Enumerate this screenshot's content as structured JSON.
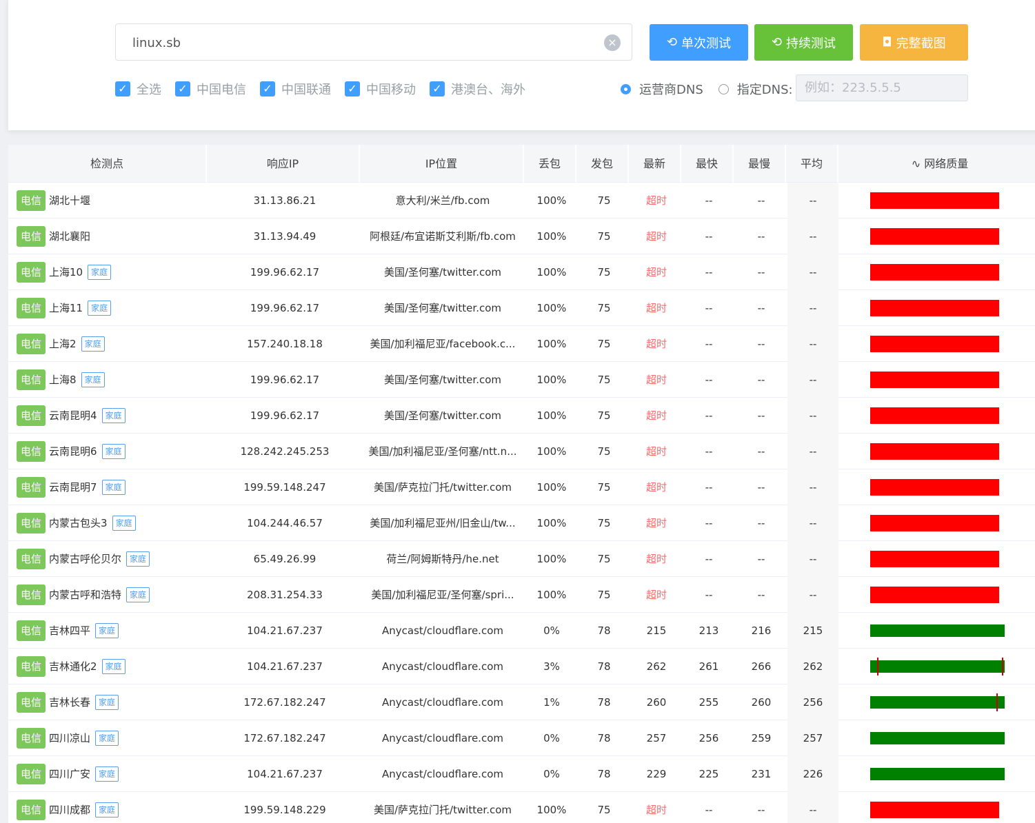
{
  "search": {
    "value": "linux.sb",
    "clear_icon": "×"
  },
  "buttons": {
    "single": {
      "icon": "⟲",
      "label": "单次测试"
    },
    "continuous": {
      "icon": "⟲",
      "label": "持续测试"
    },
    "screenshot": {
      "icon": "◘",
      "label": "完整截图"
    }
  },
  "filters": [
    {
      "label": "全选",
      "checked": true
    },
    {
      "label": "中国电信",
      "checked": true
    },
    {
      "label": "中国联通",
      "checked": true
    },
    {
      "label": "中国移动",
      "checked": true
    },
    {
      "label": "港澳台、海外",
      "checked": true
    }
  ],
  "dns": {
    "option_isp": "运营商DNS",
    "option_custom": "指定DNS:",
    "selected": "运营商DNS",
    "custom_placeholder": "例如：223.5.5.5"
  },
  "table": {
    "headers": {
      "loc": "检测点",
      "ip": "响应IP",
      "pos": "IP位置",
      "loss": "丢包",
      "sent": "发包",
      "last": "最新",
      "fast": "最快",
      "slow": "最慢",
      "avg": "平均",
      "quality_icon": "∿",
      "quality": "网络质量"
    },
    "isp_tag": "电信",
    "home_tag": "家庭",
    "timeout": "超时",
    "rows": [
      {
        "isp": "电信",
        "name": "湖北十堰",
        "home": "",
        "ip": "31.13.86.21",
        "pos": "意大利/米兰/fb.com",
        "loss": "100%",
        "sent": "75",
        "last": "超时",
        "fast": "--",
        "slow": "--",
        "avg": "--",
        "quality": "bad"
      },
      {
        "isp": "电信",
        "name": "湖北襄阳",
        "home": "",
        "ip": "31.13.94.49",
        "pos": "阿根廷/布宜诺斯艾利斯/fb.com",
        "loss": "100%",
        "sent": "75",
        "last": "超时",
        "fast": "--",
        "slow": "--",
        "avg": "--",
        "quality": "bad"
      },
      {
        "isp": "电信",
        "name": "上海10",
        "home": "家庭",
        "ip": "199.96.62.17",
        "pos": "美国/圣何塞/twitter.com",
        "loss": "100%",
        "sent": "75",
        "last": "超时",
        "fast": "--",
        "slow": "--",
        "avg": "--",
        "quality": "bad"
      },
      {
        "isp": "电信",
        "name": "上海11",
        "home": "家庭",
        "ip": "199.96.62.17",
        "pos": "美国/圣何塞/twitter.com",
        "loss": "100%",
        "sent": "75",
        "last": "超时",
        "fast": "--",
        "slow": "--",
        "avg": "--",
        "quality": "bad"
      },
      {
        "isp": "电信",
        "name": "上海2",
        "home": "家庭",
        "ip": "157.240.18.18",
        "pos": "美国/加利福尼亚/facebook.c...",
        "loss": "100%",
        "sent": "75",
        "last": "超时",
        "fast": "--",
        "slow": "--",
        "avg": "--",
        "quality": "bad"
      },
      {
        "isp": "电信",
        "name": "上海8",
        "home": "家庭",
        "ip": "199.96.62.17",
        "pos": "美国/圣何塞/twitter.com",
        "loss": "100%",
        "sent": "75",
        "last": "超时",
        "fast": "--",
        "slow": "--",
        "avg": "--",
        "quality": "bad"
      },
      {
        "isp": "电信",
        "name": "云南昆明4",
        "home": "家庭",
        "ip": "199.96.62.17",
        "pos": "美国/圣何塞/twitter.com",
        "loss": "100%",
        "sent": "75",
        "last": "超时",
        "fast": "--",
        "slow": "--",
        "avg": "--",
        "quality": "bad"
      },
      {
        "isp": "电信",
        "name": "云南昆明6",
        "home": "家庭",
        "ip": "128.242.245.253",
        "pos": "美国/加利福尼亚/圣何塞/ntt.n...",
        "loss": "100%",
        "sent": "75",
        "last": "超时",
        "fast": "--",
        "slow": "--",
        "avg": "--",
        "quality": "bad"
      },
      {
        "isp": "电信",
        "name": "云南昆明7",
        "home": "家庭",
        "ip": "199.59.148.247",
        "pos": "美国/萨克拉门托/twitter.com",
        "loss": "100%",
        "sent": "75",
        "last": "超时",
        "fast": "--",
        "slow": "--",
        "avg": "--",
        "quality": "bad"
      },
      {
        "isp": "电信",
        "name": "内蒙古包头3",
        "home": "家庭",
        "ip": "104.244.46.57",
        "pos": "美国/加利福尼亚州/旧金山/tw...",
        "loss": "100%",
        "sent": "75",
        "last": "超时",
        "fast": "--",
        "slow": "--",
        "avg": "--",
        "quality": "bad"
      },
      {
        "isp": "电信",
        "name": "内蒙古呼伦贝尔",
        "home": "家庭",
        "ip": "65.49.26.99",
        "pos": "荷兰/阿姆斯特丹/he.net",
        "loss": "100%",
        "sent": "75",
        "last": "超时",
        "fast": "--",
        "slow": "--",
        "avg": "--",
        "quality": "bad"
      },
      {
        "isp": "电信",
        "name": "内蒙古呼和浩特",
        "home": "家庭",
        "ip": "208.31.254.33",
        "pos": "美国/加利福尼亚/圣何塞/spri...",
        "loss": "100%",
        "sent": "75",
        "last": "超时",
        "fast": "--",
        "slow": "--",
        "avg": "--",
        "quality": "bad"
      },
      {
        "isp": "电信",
        "name": "吉林四平",
        "home": "家庭",
        "ip": "104.21.67.237",
        "pos": "Anycast/cloudflare.com",
        "loss": "0%",
        "sent": "78",
        "last": "215",
        "fast": "213",
        "slow": "216",
        "avg": "215",
        "quality": "good",
        "ticks": []
      },
      {
        "isp": "电信",
        "name": "吉林通化2",
        "home": "家庭",
        "ip": "104.21.67.237",
        "pos": "Anycast/cloudflare.com",
        "loss": "3%",
        "sent": "78",
        "last": "262",
        "fast": "261",
        "slow": "266",
        "avg": "262",
        "quality": "good",
        "ticks": [
          0.05,
          0.98
        ]
      },
      {
        "isp": "电信",
        "name": "吉林长春",
        "home": "家庭",
        "ip": "172.67.182.247",
        "pos": "Anycast/cloudflare.com",
        "loss": "1%",
        "sent": "78",
        "last": "260",
        "fast": "255",
        "slow": "260",
        "avg": "256",
        "quality": "good",
        "ticks": [
          0.94
        ]
      },
      {
        "isp": "电信",
        "name": "四川凉山",
        "home": "家庭",
        "ip": "172.67.182.247",
        "pos": "Anycast/cloudflare.com",
        "loss": "0%",
        "sent": "78",
        "last": "257",
        "fast": "256",
        "slow": "259",
        "avg": "257",
        "quality": "good",
        "ticks": []
      },
      {
        "isp": "电信",
        "name": "四川广安",
        "home": "家庭",
        "ip": "104.21.67.237",
        "pos": "Anycast/cloudflare.com",
        "loss": "0%",
        "sent": "78",
        "last": "229",
        "fast": "225",
        "slow": "231",
        "avg": "226",
        "quality": "good",
        "ticks": []
      },
      {
        "isp": "电信",
        "name": "四川成都",
        "home": "家庭",
        "ip": "199.59.148.229",
        "pos": "美国/萨克拉门托/twitter.com",
        "loss": "100%",
        "sent": "75",
        "last": "超时",
        "fast": "--",
        "slow": "--",
        "avg": "--",
        "quality": "bad"
      }
    ]
  }
}
